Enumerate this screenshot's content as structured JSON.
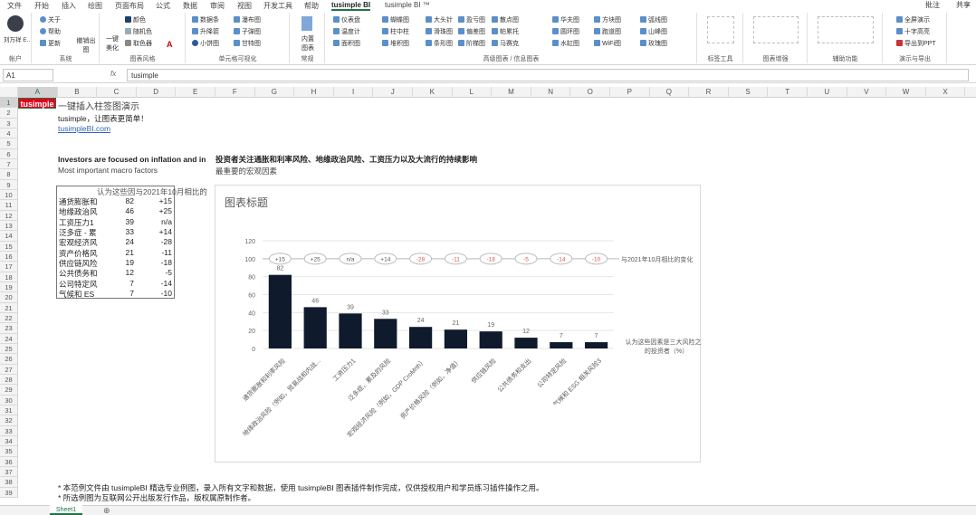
{
  "tabs": [
    "文件",
    "开始",
    "插入",
    "绘图",
    "页面布局",
    "公式",
    "数据",
    "审阅",
    "视图",
    "开发工具",
    "帮助",
    "tusimple BI",
    "tusimple BI ™"
  ],
  "top_right": {
    "comment": "批注",
    "share": "共享"
  },
  "ribbon": {
    "account": {
      "user": "刘万祥 E..",
      "label": "帐户"
    },
    "system": {
      "items": [
        "关于",
        "帮助",
        "更新",
        "撤销出图"
      ],
      "label": "系统"
    },
    "style": {
      "items": [
        "一键美化",
        "颜色",
        "随机色",
        "取色器"
      ],
      "label": "图表风格"
    },
    "cellviz": {
      "items": [
        "数据条",
        "瀑布图",
        "升降箭",
        "子弹图",
        "小饼图",
        "甘特图"
      ],
      "label": "单元格可视化"
    },
    "normal": {
      "items": [
        "内置图表"
      ],
      "label": "常规"
    },
    "advanced": {
      "items": [
        "仪表盘",
        "蝴蝶图",
        "大头针",
        "盈亏图",
        "散点图",
        "华夫图",
        "方块图",
        "弧线图",
        "温度计",
        "柱中柱",
        "滑珠图",
        "偏差图",
        "帕累托",
        "圆环图",
        "跑道图",
        "山峰图",
        "面积图",
        "堆积图",
        "条形图",
        "阶梯图",
        "马赛克",
        "水缸图",
        "WiFi图",
        "玫瑰图"
      ],
      "label": "高级图表 / 信息图表"
    },
    "labeltools": {
      "label": "标签工具"
    },
    "enhance": {
      "label": "图表增强"
    },
    "assist": {
      "label": "辅助功能"
    },
    "export": {
      "items": [
        "全屏演示",
        "十字高亮",
        "导出到PPT"
      ],
      "label": "演示与导出"
    }
  },
  "formula_bar": {
    "name_box": "A1",
    "fx": "fx",
    "value": "tusimple"
  },
  "columns": [
    "A",
    "B",
    "C",
    "D",
    "E",
    "F",
    "G",
    "H",
    "I",
    "J",
    "K",
    "L",
    "M",
    "N",
    "O",
    "P",
    "Q",
    "R",
    "S",
    "T",
    "U",
    "V",
    "W",
    "X"
  ],
  "rows": [
    "1",
    "2",
    "3",
    "4",
    "5",
    "6",
    "7",
    "8",
    "9",
    "10",
    "11",
    "12",
    "13",
    "14",
    "15",
    "16",
    "17",
    "18",
    "19",
    "20",
    "21",
    "22",
    "23",
    "24",
    "25",
    "26",
    "27",
    "28",
    "29",
    "30",
    "31",
    "32",
    "33",
    "34",
    "35",
    "36",
    "37",
    "38",
    "39"
  ],
  "sheet": {
    "logo": "tusimple",
    "title": "一键插入柱签图演示",
    "subtitle": "tusimple，让图表更简单！",
    "link": "tusimpleBI.com",
    "heading_en": "Investors are focused on inflation and in",
    "heading_cn": "投资者关注通胀和利率风险、地缘政治风险、工资压力以及大流行的持续影响",
    "sub_en": "Most important macro factors",
    "sub_cn": "最重要的宏观因素",
    "table_header": "认为这些因与2021年10月相比的",
    "table": [
      [
        "通货膨胀和",
        "82",
        "+15"
      ],
      [
        "地缘政治风",
        "46",
        "+25"
      ],
      [
        "工资压力1",
        "39",
        "n/a"
      ],
      [
        "泛多症 - 累",
        "33",
        "+14"
      ],
      [
        "宏观经济风",
        "24",
        "-28"
      ],
      [
        "资产价格风",
        "21",
        "-11"
      ],
      [
        "供应链风险",
        "19",
        "-18"
      ],
      [
        "公共债务和",
        "12",
        "-5"
      ],
      [
        "公司特定风",
        "7",
        "-14"
      ],
      [
        "气候和 ES",
        "7",
        "-10"
      ]
    ],
    "notes": [
      "* 本范例文件由 tusimpleBI 精选专业例图，录入所有文字和数据，使用 tusimpleBI 图表插件制作完成，仅供授权用户和学员练习插件操作之用。",
      "* 所选例图为互联网公开出版发行作品，版权属原制作者。"
    ],
    "tab": "Sheet1"
  },
  "chart_data": {
    "type": "bar",
    "title": "图表标题",
    "categories": [
      "通货膨胀和利率风险",
      "地缘政治风险（例如，贸易战和内战...",
      "工资压力1",
      "泛多症，累及的风险",
      "宏观经济风险（例如，GDP CroMrth）",
      "资产价格风险（例如，净值）",
      "供应链风险",
      "公共债务和支出",
      "公司特定风险",
      "气候和 ESG 相关风险3"
    ],
    "values": [
      82,
      46,
      39,
      33,
      24,
      21,
      19,
      12,
      7,
      7
    ],
    "changes": [
      "+15",
      "+25",
      "n/a",
      "+14",
      "-28",
      "-11",
      "-18",
      "-5",
      "-14",
      "-10"
    ],
    "series_label": "认为这些因素是三大风险之一的投资者（%）",
    "change_label": "与2021年10月相比的变化",
    "yticks": [
      0,
      20,
      40,
      60,
      80,
      100,
      120
    ],
    "ylim": [
      0,
      120
    ],
    "bar_color": "#0f1b2c",
    "negative_color": "#d9534f"
  }
}
